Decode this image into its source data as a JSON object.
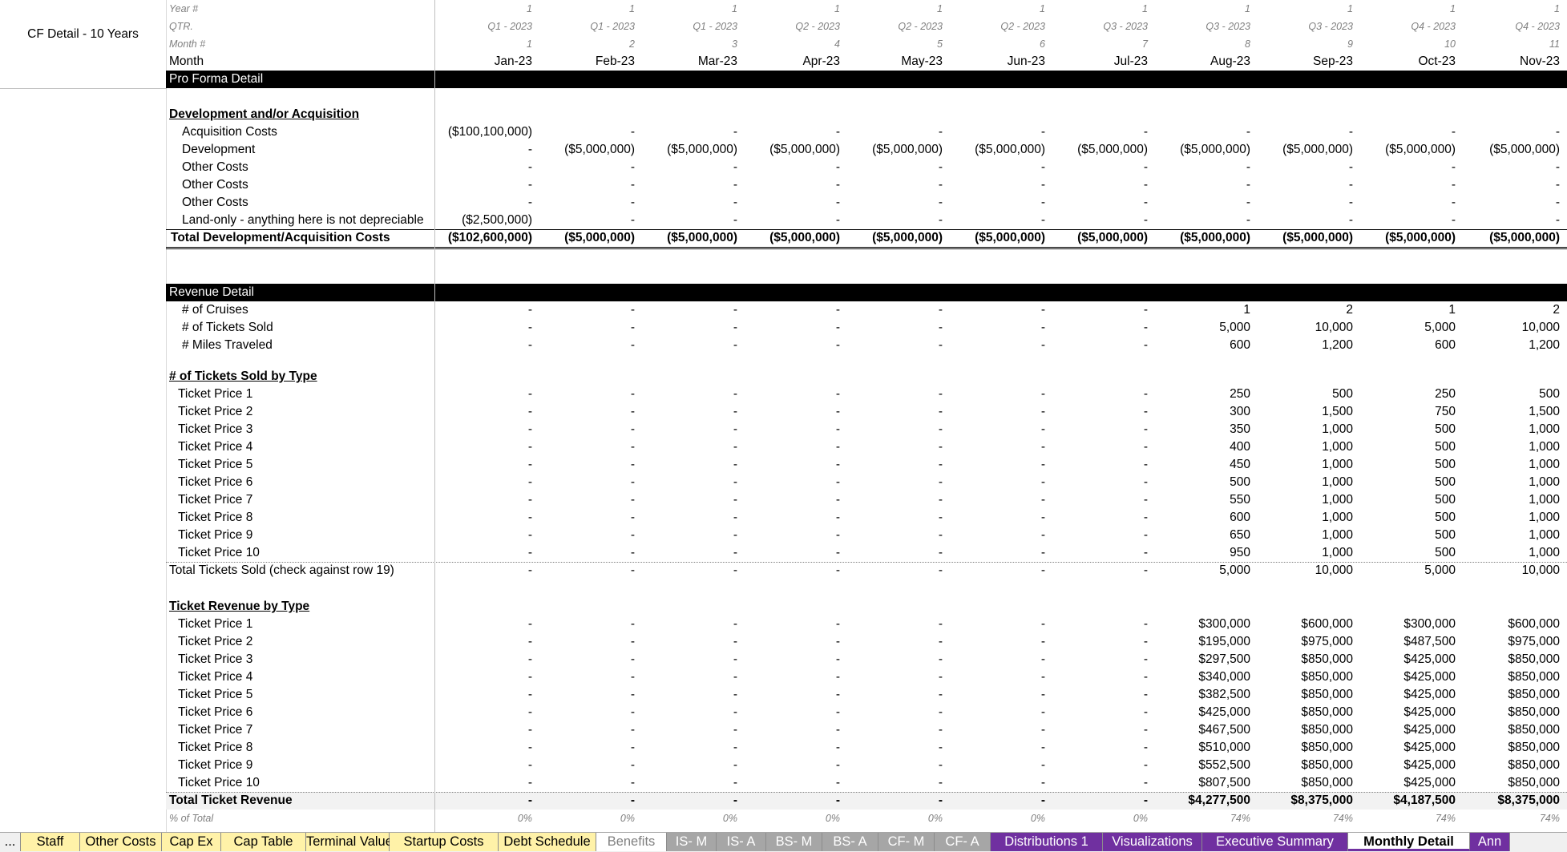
{
  "sheet_title": "CF Detail - 10 Years",
  "months": [
    "Jan-23",
    "Feb-23",
    "Mar-23",
    "Apr-23",
    "May-23",
    "Jun-23",
    "Jul-23",
    "Aug-23",
    "Sep-23",
    "Oct-23",
    "Nov-23"
  ],
  "header_rows": [
    {
      "label": "Year #",
      "values": [
        "1",
        "1",
        "1",
        "1",
        "1",
        "1",
        "1",
        "1",
        "1",
        "1",
        "1"
      ]
    },
    {
      "label": "QTR.",
      "values": [
        "Q1 - 2023",
        "Q1 - 2023",
        "Q1 - 2023",
        "Q2 - 2023",
        "Q2 - 2023",
        "Q2 - 2023",
        "Q3 - 2023",
        "Q3 - 2023",
        "Q3 - 2023",
        "Q4 - 2023",
        "Q4 - 2023"
      ]
    },
    {
      "label": "Month #",
      "values": [
        "1",
        "2",
        "3",
        "4",
        "5",
        "6",
        "7",
        "8",
        "9",
        "10",
        "11"
      ]
    }
  ],
  "month_label": "Month",
  "pro_forma_label": "Pro Forma Detail",
  "development": {
    "heading": "Development and/or Acquisition",
    "rows": [
      {
        "label": "Acquisition Costs",
        "values": [
          "($100,100,000)",
          "-",
          "-",
          "-",
          "-",
          "-",
          "-",
          "-",
          "-",
          "-",
          "-"
        ]
      },
      {
        "label": "Development",
        "values": [
          "-",
          "($5,000,000)",
          "($5,000,000)",
          "($5,000,000)",
          "($5,000,000)",
          "($5,000,000)",
          "($5,000,000)",
          "($5,000,000)",
          "($5,000,000)",
          "($5,000,000)",
          "($5,000,000)"
        ]
      },
      {
        "label": "Other Costs",
        "values": [
          "-",
          "-",
          "-",
          "-",
          "-",
          "-",
          "-",
          "-",
          "-",
          "-",
          "-"
        ]
      },
      {
        "label": "Other Costs",
        "values": [
          "-",
          "-",
          "-",
          "-",
          "-",
          "-",
          "-",
          "-",
          "-",
          "-",
          "-"
        ]
      },
      {
        "label": "Other Costs",
        "values": [
          "-",
          "-",
          "-",
          "-",
          "-",
          "-",
          "-",
          "-",
          "-",
          "-",
          "-"
        ]
      },
      {
        "label": "Land-only - anything here is not depreciable",
        "values": [
          "($2,500,000)",
          "-",
          "-",
          "-",
          "-",
          "-",
          "-",
          "-",
          "-",
          "-",
          "-"
        ]
      }
    ],
    "total": {
      "label": "Total Development/Acquisition Costs",
      "values": [
        "($102,600,000)",
        "($5,000,000)",
        "($5,000,000)",
        "($5,000,000)",
        "($5,000,000)",
        "($5,000,000)",
        "($5,000,000)",
        "($5,000,000)",
        "($5,000,000)",
        "($5,000,000)",
        "($5,000,000)"
      ]
    }
  },
  "revenue": {
    "heading": "Revenue Detail",
    "rows": [
      {
        "label": "# of Cruises",
        "values": [
          "-",
          "-",
          "-",
          "-",
          "-",
          "-",
          "-",
          "1",
          "2",
          "1",
          "2"
        ]
      },
      {
        "label": "# of Tickets Sold",
        "values": [
          "-",
          "-",
          "-",
          "-",
          "-",
          "-",
          "-",
          "5,000",
          "10,000",
          "5,000",
          "10,000"
        ]
      },
      {
        "label": "# Miles Traveled",
        "values": [
          "-",
          "-",
          "-",
          "-",
          "-",
          "-",
          "-",
          "600",
          "1,200",
          "600",
          "1,200"
        ]
      }
    ]
  },
  "tickets_by_type": {
    "heading": "# of Tickets Sold by Type",
    "rows": [
      {
        "label": "Ticket Price 1",
        "values": [
          "-",
          "-",
          "-",
          "-",
          "-",
          "-",
          "-",
          "250",
          "500",
          "250",
          "500"
        ]
      },
      {
        "label": "Ticket Price 2",
        "values": [
          "-",
          "-",
          "-",
          "-",
          "-",
          "-",
          "-",
          "300",
          "1,500",
          "750",
          "1,500"
        ]
      },
      {
        "label": "Ticket Price 3",
        "values": [
          "-",
          "-",
          "-",
          "-",
          "-",
          "-",
          "-",
          "350",
          "1,000",
          "500",
          "1,000"
        ]
      },
      {
        "label": "Ticket Price 4",
        "values": [
          "-",
          "-",
          "-",
          "-",
          "-",
          "-",
          "-",
          "400",
          "1,000",
          "500",
          "1,000"
        ]
      },
      {
        "label": "Ticket Price 5",
        "values": [
          "-",
          "-",
          "-",
          "-",
          "-",
          "-",
          "-",
          "450",
          "1,000",
          "500",
          "1,000"
        ]
      },
      {
        "label": "Ticket Price 6",
        "values": [
          "-",
          "-",
          "-",
          "-",
          "-",
          "-",
          "-",
          "500",
          "1,000",
          "500",
          "1,000"
        ]
      },
      {
        "label": "Ticket Price 7",
        "values": [
          "-",
          "-",
          "-",
          "-",
          "-",
          "-",
          "-",
          "550",
          "1,000",
          "500",
          "1,000"
        ]
      },
      {
        "label": "Ticket Price 8",
        "values": [
          "-",
          "-",
          "-",
          "-",
          "-",
          "-",
          "-",
          "600",
          "1,000",
          "500",
          "1,000"
        ]
      },
      {
        "label": "Ticket Price 9",
        "values": [
          "-",
          "-",
          "-",
          "-",
          "-",
          "-",
          "-",
          "650",
          "1,000",
          "500",
          "1,000"
        ]
      },
      {
        "label": "Ticket Price 10",
        "values": [
          "-",
          "-",
          "-",
          "-",
          "-",
          "-",
          "-",
          "950",
          "1,000",
          "500",
          "1,000"
        ]
      }
    ],
    "total": {
      "label": "Total Tickets Sold (check against row 19)",
      "values": [
        "-",
        "-",
        "-",
        "-",
        "-",
        "-",
        "-",
        "5,000",
        "10,000",
        "5,000",
        "10,000"
      ]
    }
  },
  "ticket_revenue": {
    "heading": "Ticket Revenue by Type",
    "rows": [
      {
        "label": "Ticket Price 1",
        "values": [
          "-",
          "-",
          "-",
          "-",
          "-",
          "-",
          "-",
          "$300,000",
          "$600,000",
          "$300,000",
          "$600,000"
        ]
      },
      {
        "label": "Ticket Price 2",
        "values": [
          "-",
          "-",
          "-",
          "-",
          "-",
          "-",
          "-",
          "$195,000",
          "$975,000",
          "$487,500",
          "$975,000"
        ]
      },
      {
        "label": "Ticket Price 3",
        "values": [
          "-",
          "-",
          "-",
          "-",
          "-",
          "-",
          "-",
          "$297,500",
          "$850,000",
          "$425,000",
          "$850,000"
        ]
      },
      {
        "label": "Ticket Price 4",
        "values": [
          "-",
          "-",
          "-",
          "-",
          "-",
          "-",
          "-",
          "$340,000",
          "$850,000",
          "$425,000",
          "$850,000"
        ]
      },
      {
        "label": "Ticket Price 5",
        "values": [
          "-",
          "-",
          "-",
          "-",
          "-",
          "-",
          "-",
          "$382,500",
          "$850,000",
          "$425,000",
          "$850,000"
        ]
      },
      {
        "label": "Ticket Price 6",
        "values": [
          "-",
          "-",
          "-",
          "-",
          "-",
          "-",
          "-",
          "$425,000",
          "$850,000",
          "$425,000",
          "$850,000"
        ]
      },
      {
        "label": "Ticket Price 7",
        "values": [
          "-",
          "-",
          "-",
          "-",
          "-",
          "-",
          "-",
          "$467,500",
          "$850,000",
          "$425,000",
          "$850,000"
        ]
      },
      {
        "label": "Ticket Price 8",
        "values": [
          "-",
          "-",
          "-",
          "-",
          "-",
          "-",
          "-",
          "$510,000",
          "$850,000",
          "$425,000",
          "$850,000"
        ]
      },
      {
        "label": "Ticket Price 9",
        "values": [
          "-",
          "-",
          "-",
          "-",
          "-",
          "-",
          "-",
          "$552,500",
          "$850,000",
          "$425,000",
          "$850,000"
        ]
      },
      {
        "label": "Ticket Price 10",
        "values": [
          "-",
          "-",
          "-",
          "-",
          "-",
          "-",
          "-",
          "$807,500",
          "$850,000",
          "$425,000",
          "$850,000"
        ]
      }
    ],
    "total": {
      "label": "Total Ticket Revenue",
      "values": [
        "-",
        "-",
        "-",
        "-",
        "-",
        "-",
        "-",
        "$4,277,500",
        "$8,375,000",
        "$4,187,500",
        "$8,375,000"
      ]
    },
    "pct": {
      "label": "% of Total",
      "values": [
        "0%",
        "0%",
        "0%",
        "0%",
        "0%",
        "0%",
        "0%",
        "74%",
        "74%",
        "74%",
        "74%"
      ]
    }
  },
  "tabs": [
    {
      "label": "...",
      "style": "nav"
    },
    {
      "label": "Staff",
      "style": "yellow"
    },
    {
      "label": "Other Costs",
      "style": "yellow"
    },
    {
      "label": "Cap Ex",
      "style": "yellow"
    },
    {
      "label": "Cap Table",
      "style": "yellow"
    },
    {
      "label": "Terminal Value",
      "style": "yellow"
    },
    {
      "label": "Startup Costs",
      "style": "yellow"
    },
    {
      "label": "Debt Schedule",
      "style": "yellow"
    },
    {
      "label": "Benefits",
      "style": "white"
    },
    {
      "label": "IS- M",
      "style": "grey"
    },
    {
      "label": "IS- A",
      "style": "grey"
    },
    {
      "label": "BS- M",
      "style": "grey"
    },
    {
      "label": "BS- A",
      "style": "grey"
    },
    {
      "label": "CF- M",
      "style": "grey"
    },
    {
      "label": "CF- A",
      "style": "grey"
    },
    {
      "label": "Distributions 1",
      "style": "purple"
    },
    {
      "label": "Visualizations",
      "style": "purple"
    },
    {
      "label": "Executive Summary",
      "style": "purple"
    },
    {
      "label": "Monthly Detail",
      "style": "active"
    },
    {
      "label": "Ann",
      "style": "purple"
    }
  ]
}
